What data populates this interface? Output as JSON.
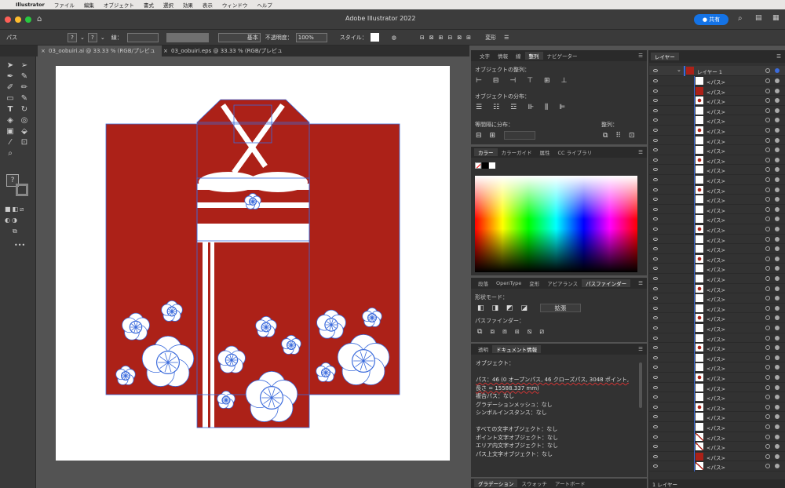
{
  "menubar": {
    "apple": "",
    "items": [
      "Illustrator",
      "ファイル",
      "編集",
      "オブジェクト",
      "書式",
      "選択",
      "効果",
      "表示",
      "ウィンドウ",
      "ヘルプ"
    ]
  },
  "app": {
    "title": "Adobe Illustrator 2022",
    "share": "共有"
  },
  "control": {
    "selection": "パス",
    "stroke_label": "線：",
    "brush": "基本",
    "opacity_label": "不透明度：",
    "opacity_value": "100%",
    "style_label": "スタイル：",
    "transform_label": "変形"
  },
  "doc_tabs": [
    "03_oobuiri.ai @ 33.33 % (RGB/プレビュー)",
    "03_oobuiri.eps @ 33.33 % (RGB/プレビュー)"
  ],
  "panels": {
    "align": {
      "tabs": [
        "文字",
        "情報",
        "線",
        "整列",
        "ナビゲーター"
      ],
      "align_objects": "オブジェクトの整列：",
      "distribute_objects": "オブジェクトの分布：",
      "distribute_spacing": "等間隔に分布：",
      "align_to": "整列："
    },
    "color": {
      "tabs": [
        "カラー",
        "カラーガイド",
        "属性",
        "CC ライブラリ"
      ]
    },
    "pathfinder": {
      "tabs": [
        "段落",
        "OpenType",
        "変形",
        "アピアランス",
        "パスファインダー"
      ],
      "shape_modes": "形状モード：",
      "expand": "拡張",
      "pathfinders": "パスファインダー："
    },
    "docinfo": {
      "tabs": [
        "透明",
        "ドキュメント情報"
      ],
      "lines": [
        "オブジェクト：",
        "",
        "パス：46 (0 オープンパス, 46 クローズパス, 3048 ポイント,",
        "長さ = 15588.337 mm)",
        "複合パス：なし",
        "グラデーションメッシュ：なし",
        "シンボルインスタンス：なし",
        "",
        "すべての文字オブジェクト：なし",
        "ポイント文字オブジェクト：なし",
        "エリア内文字オブジェクト：なし",
        "パス上文字オブジェクト：なし"
      ]
    },
    "bottom": {
      "tabs": [
        "グラデーション",
        "スウォッチ",
        "アートボード"
      ]
    }
  },
  "layers": {
    "tab": "レイヤー",
    "layer_name": "レイヤー 1",
    "item_label": "<パス>",
    "count": "1 レイヤー",
    "thumbs": [
      "white",
      "red",
      "flower",
      "white",
      "white",
      "flower",
      "white",
      "white",
      "flower",
      "white",
      "white",
      "flower",
      "white",
      "white",
      "white",
      "flower",
      "white",
      "white",
      "flower",
      "white",
      "white",
      "flower",
      "white",
      "white",
      "flower",
      "white",
      "white",
      "flower",
      "white",
      "white",
      "flower",
      "white",
      "white",
      "flower",
      "white",
      "white",
      "line",
      "line",
      "red",
      "line"
    ]
  },
  "status": {
    "zoom": "33.33%"
  },
  "colors": {
    "kimono": "#ac2118",
    "flower": "#ffffff",
    "path": "#3b6bdc"
  }
}
